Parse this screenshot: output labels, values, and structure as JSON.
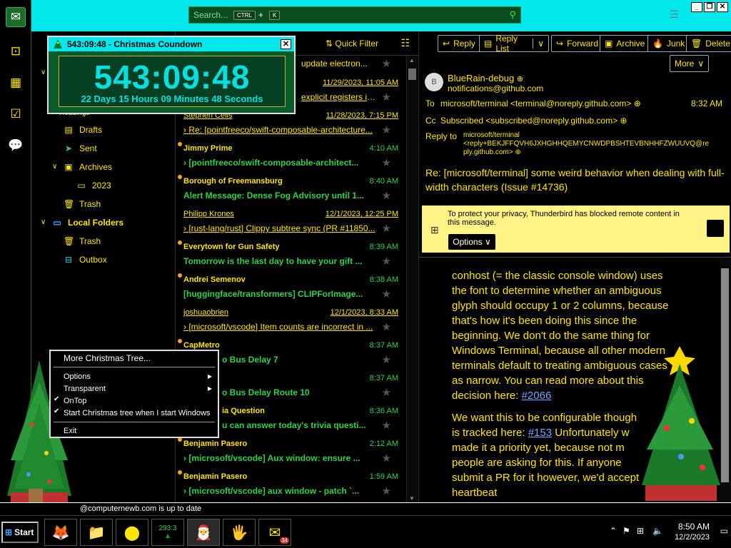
{
  "search": {
    "placeholder": "Search...",
    "kbd": "CTRL",
    "plus": "+",
    "key": "K"
  },
  "window_controls": [
    "_",
    "❐",
    "✕"
  ],
  "folders": {
    "items": [
      {
        "label": "Drafts",
        "icon": "draft-icon"
      },
      {
        "label": "Sent",
        "icon": "sent-icon"
      },
      {
        "label": "Archives",
        "icon": "archive-icon"
      },
      {
        "label": "2023",
        "icon": "folder-icon"
      },
      {
        "label": "Trash",
        "icon": "trash-icon"
      },
      {
        "label": "Local Folders",
        "icon": "folder-icon"
      },
      {
        "label": "Trash",
        "icon": "trash-icon"
      },
      {
        "label": "Outbox",
        "icon": "outbox-icon"
      }
    ],
    "partial_label": "Readings"
  },
  "message_list": {
    "quick_filter": "Quick Filter",
    "messages": [
      {
        "from": "",
        "date": "",
        "subject": "update electron..."
      },
      {
        "from": "",
        "date": "11/29/2023, 11:05 AM",
        "subject": "explicit registers in c..."
      },
      {
        "from": "Stephen Celis",
        "date": "11/28/2023, 7:15 PM",
        "subject": "Re: [pointfreeco/swift-composable-architecture..."
      },
      {
        "from": "Jimmy Prime",
        "date": "4:10 AM",
        "subject": "[pointfreeco/swift-composable-architect..."
      },
      {
        "from": "Borough of Freemansburg",
        "date": "8:40 AM",
        "subject": "Alert Message: Dense Fog Advisory until 1..."
      },
      {
        "from": "Philipp Krones",
        "date": "12/1/2023, 12:25 PM",
        "subject": "[rust-lang/rust] Clippy subtree sync (PR #11850..."
      },
      {
        "from": "Everytown for Gun Safety",
        "date": "8:39 AM",
        "subject": "Tomorrow is the last day to have your gift ..."
      },
      {
        "from": "Andrei Semenov",
        "date": "8:38 AM",
        "subject": "[huggingface/transformers] CLIPForImage..."
      },
      {
        "from": "joshuaobrien",
        "date": "12/1/2023, 8:33 AM",
        "subject": "[microsoft/vscode] Item counts are incorrect in ..."
      },
      {
        "from": "CapMetro",
        "date": "8:37 AM",
        "subject": "o Bus Delay 7"
      },
      {
        "from": "",
        "date": "8:37 AM",
        "subject": "o Bus Delay Route 10"
      },
      {
        "from": "ia Question",
        "date": "8:36 AM",
        "subject": "u can answer today's trivia questi..."
      },
      {
        "from": "Benjamin Pasero",
        "date": "2:12 AM",
        "subject": "[microsoft/vscode] Aux window: ensure ..."
      },
      {
        "from": "Benjamin Pasero",
        "date": "1:59 AM",
        "subject": "[microsoft/vscode] aux window - patch `..."
      }
    ]
  },
  "reader": {
    "buttons": [
      "Reply",
      "Reply List",
      "Forward",
      "Archive",
      "Junk",
      "Delete",
      "More"
    ],
    "from_name": "BlueRain-debug",
    "from_addr": "notifications@github.com",
    "avatar": "B",
    "to_label": "To",
    "to_value": "microsoft/terminal <terminal@noreply.github.com>",
    "time": "8:32 AM",
    "cc_label": "Cc",
    "cc_value": "Subscribed <subscribed@noreply.github.com>",
    "replyto_label": "Reply to",
    "replyto_line1": "microsoft/terminal",
    "replyto_line2": "<reply+BEKJFFQVH6JXHGHHQEMYCNWDPBSHTEVBNHHFZWUUVQ@re",
    "replyto_line3": "ply.github.com>",
    "subject": "Re: [microsoft/terminal] some weird behavior when dealing with full-width characters (Issue #14736)",
    "privacy_text": "To protect your privacy, Thunderbird has blocked remote content in this message.",
    "privacy_button": "Options",
    "body_p1": "conhost (= the classic console window) uses the font to determine whether an ambiguous glyph should occupy 1 or 2 columns, because that's how it's been doing this since the beginning. We don't do the same thing for Windows Terminal, because all other modern terminals default to treating ambiguous cases as narrow. You can read more about this decision here:",
    "body_link1": "#2066",
    "body_p2a": "We want this to be configurable though",
    "body_p2b": "is tracked here:",
    "body_link2": "#153",
    "body_p2c": "Unfortunately w",
    "body_p2d": "made it a priority yet, because not m",
    "body_p2e": "people are asking for this. If anyone",
    "body_p2f": "submit a PR for it however, we'd accept",
    "body_p2g": "heartbeat"
  },
  "status": {
    "text": "@computernewb.com is up to date"
  },
  "countdown": {
    "title": "543:09:48 - Christmas Coundown",
    "big": "543:09:48",
    "detail": "22 Days 15 Hours 09 Minutes 48 Seconds"
  },
  "context_menu": {
    "head": "More Christmas Tree...",
    "items": [
      "Options",
      "Transparent",
      "OnTop",
      "Start Christmas tree when I start Windows",
      "Exit"
    ]
  },
  "taskbar": {
    "start": "Start",
    "badge_counter": "293:3",
    "thunderbird_badge": "34",
    "time": "8:50 AM",
    "date": "12/2/2023"
  },
  "colors": {
    "accent_cyan": "#00e8ec",
    "text_yellow": "#ffe600",
    "unread_green": "#2ed14a",
    "privacy_bg": "#fff386"
  }
}
